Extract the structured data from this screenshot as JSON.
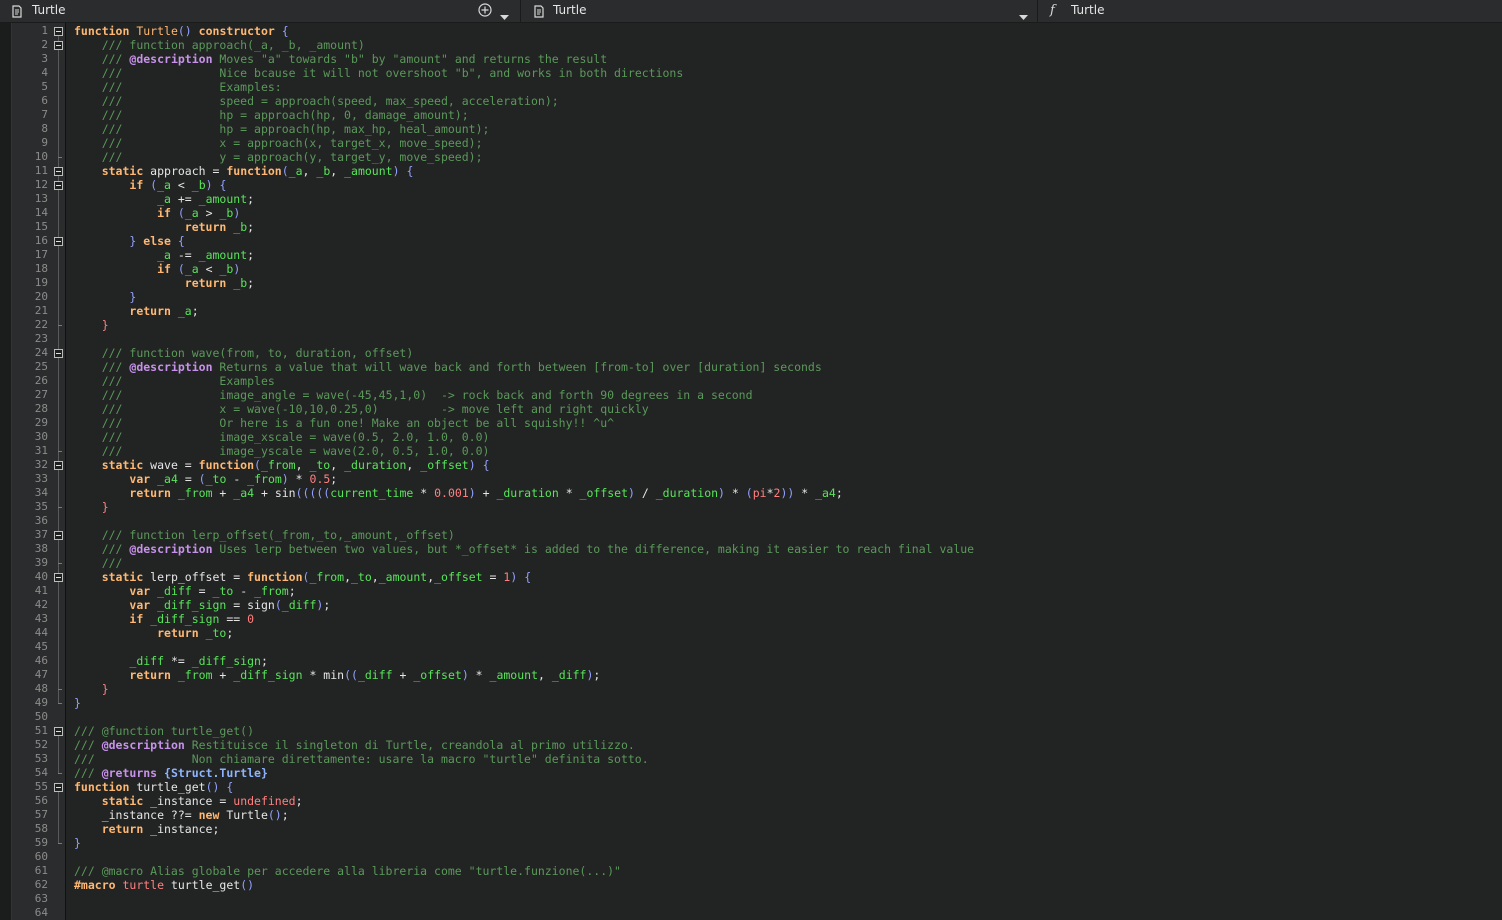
{
  "tabs": [
    {
      "label": "Turtle",
      "icon": "script-icon"
    },
    {
      "label": "Turtle",
      "icon": "script-icon"
    },
    {
      "label": "Turtle",
      "icon": "function-icon"
    }
  ],
  "colors": {
    "background": "#222323",
    "keyword": "#ffb871",
    "comment": "#5b995b",
    "local_variable": "#58e55a",
    "number": "#ff8080",
    "jsdoc_tag": "#c792ea"
  },
  "editor": {
    "line_count": 64,
    "lines": [
      [
        [
          "kw",
          "function"
        ],
        [
          "t",
          " "
        ],
        [
          "fn",
          "Turtle"
        ],
        [
          "pu",
          "()"
        ],
        [
          "t",
          " "
        ],
        [
          "kw",
          "constructor"
        ],
        [
          "t",
          " "
        ],
        [
          "pu",
          "{"
        ]
      ],
      [
        [
          "t",
          "    "
        ],
        [
          "cm",
          "/// function approach(_a, _b, _amount)"
        ]
      ],
      [
        [
          "t",
          "    "
        ],
        [
          "cm",
          "/// "
        ],
        [
          "tag",
          "@description"
        ],
        [
          "cm",
          " Moves \"a\" towards \"b\" by \"amount\" and returns the result"
        ]
      ],
      [
        [
          "t",
          "    "
        ],
        [
          "cm",
          "///              Nice bcause it will not overshoot \"b\", and works in both directions"
        ]
      ],
      [
        [
          "t",
          "    "
        ],
        [
          "cm",
          "///              Examples:"
        ]
      ],
      [
        [
          "t",
          "    "
        ],
        [
          "cm",
          "///              speed = approach(speed, max_speed, acceleration);"
        ]
      ],
      [
        [
          "t",
          "    "
        ],
        [
          "cm",
          "///              hp = approach(hp, 0, damage_amount);"
        ]
      ],
      [
        [
          "t",
          "    "
        ],
        [
          "cm",
          "///              hp = approach(hp, max_hp, heal_amount);"
        ]
      ],
      [
        [
          "t",
          "    "
        ],
        [
          "cm",
          "///              x = approach(x, target_x, move_speed);"
        ]
      ],
      [
        [
          "t",
          "    "
        ],
        [
          "cm",
          "///              y = approach(y, target_y, move_speed);"
        ]
      ],
      [
        [
          "t",
          "    "
        ],
        [
          "kw",
          "static"
        ],
        [
          "t",
          " approach = "
        ],
        [
          "kw",
          "function"
        ],
        [
          "pu",
          "("
        ],
        [
          "va",
          "_a"
        ],
        [
          "t",
          ", "
        ],
        [
          "va",
          "_b"
        ],
        [
          "t",
          ", "
        ],
        [
          "va",
          "_amount"
        ],
        [
          "pu",
          ")"
        ],
        [
          "t",
          " "
        ],
        [
          "pu",
          "{"
        ]
      ],
      [
        [
          "t",
          "        "
        ],
        [
          "kw",
          "if"
        ],
        [
          "t",
          " "
        ],
        [
          "pu",
          "("
        ],
        [
          "va",
          "_a"
        ],
        [
          "t",
          " < "
        ],
        [
          "va",
          "_b"
        ],
        [
          "pu",
          ")"
        ],
        [
          "t",
          " "
        ],
        [
          "pu",
          "{"
        ]
      ],
      [
        [
          "t",
          "            "
        ],
        [
          "va",
          "_a"
        ],
        [
          "t",
          " += "
        ],
        [
          "va",
          "_amount"
        ],
        [
          "t",
          ";"
        ]
      ],
      [
        [
          "t",
          "            "
        ],
        [
          "kw",
          "if"
        ],
        [
          "t",
          " "
        ],
        [
          "pu",
          "("
        ],
        [
          "va",
          "_a"
        ],
        [
          "t",
          " > "
        ],
        [
          "va",
          "_b"
        ],
        [
          "pu",
          ")"
        ]
      ],
      [
        [
          "t",
          "                "
        ],
        [
          "kw",
          "return"
        ],
        [
          "t",
          " "
        ],
        [
          "va",
          "_b"
        ],
        [
          "t",
          ";"
        ]
      ],
      [
        [
          "t",
          "        "
        ],
        [
          "pu",
          "}"
        ],
        [
          "t",
          " "
        ],
        [
          "kw",
          "else"
        ],
        [
          "t",
          " "
        ],
        [
          "pu",
          "{"
        ]
      ],
      [
        [
          "t",
          "            "
        ],
        [
          "va",
          "_a"
        ],
        [
          "t",
          " -= "
        ],
        [
          "va",
          "_amount"
        ],
        [
          "t",
          ";"
        ]
      ],
      [
        [
          "t",
          "            "
        ],
        [
          "kw",
          "if"
        ],
        [
          "t",
          " "
        ],
        [
          "pu",
          "("
        ],
        [
          "va",
          "_a"
        ],
        [
          "t",
          " < "
        ],
        [
          "va",
          "_b"
        ],
        [
          "pu",
          ")"
        ]
      ],
      [
        [
          "t",
          "                "
        ],
        [
          "kw",
          "return"
        ],
        [
          "t",
          " "
        ],
        [
          "va",
          "_b"
        ],
        [
          "t",
          ";"
        ]
      ],
      [
        [
          "t",
          "        "
        ],
        [
          "pu",
          "}"
        ]
      ],
      [
        [
          "t",
          "        "
        ],
        [
          "kw",
          "return"
        ],
        [
          "t",
          " "
        ],
        [
          "va",
          "_a"
        ],
        [
          "t",
          ";"
        ]
      ],
      [
        [
          "t",
          "    "
        ],
        [
          "bn",
          "}"
        ]
      ],
      [],
      [
        [
          "t",
          "    "
        ],
        [
          "cm",
          "/// function wave(from, to, duration, offset)"
        ]
      ],
      [
        [
          "t",
          "    "
        ],
        [
          "cm",
          "/// "
        ],
        [
          "tag",
          "@description"
        ],
        [
          "cm",
          " Returns a value that will wave back and forth between [from-to] over [duration] seconds"
        ]
      ],
      [
        [
          "t",
          "    "
        ],
        [
          "cm",
          "///              Examples"
        ]
      ],
      [
        [
          "t",
          "    "
        ],
        [
          "cm",
          "///              image_angle = wave(-45,45,1,0)  -> rock back and forth 90 degrees in a second"
        ]
      ],
      [
        [
          "t",
          "    "
        ],
        [
          "cm",
          "///              x = wave(-10,10,0.25,0)         -> move left and right quickly"
        ]
      ],
      [
        [
          "t",
          "    "
        ],
        [
          "cm",
          "///              Or here is a fun one! Make an object be all squishy!! ^u^"
        ]
      ],
      [
        [
          "t",
          "    "
        ],
        [
          "cm",
          "///              image_xscale = wave(0.5, 2.0, 1.0, 0.0)"
        ]
      ],
      [
        [
          "t",
          "    "
        ],
        [
          "cm",
          "///              image_yscale = wave(2.0, 0.5, 1.0, 0.0)"
        ]
      ],
      [
        [
          "t",
          "    "
        ],
        [
          "kw",
          "static"
        ],
        [
          "t",
          " wave = "
        ],
        [
          "kw",
          "function"
        ],
        [
          "pu",
          "("
        ],
        [
          "va",
          "_from"
        ],
        [
          "t",
          ", "
        ],
        [
          "va",
          "_to"
        ],
        [
          "t",
          ", "
        ],
        [
          "va",
          "_duration"
        ],
        [
          "t",
          ", "
        ],
        [
          "va",
          "_offset"
        ],
        [
          "pu",
          ")"
        ],
        [
          "t",
          " "
        ],
        [
          "pu",
          "{"
        ]
      ],
      [
        [
          "t",
          "        "
        ],
        [
          "kw",
          "var"
        ],
        [
          "t",
          " "
        ],
        [
          "va",
          "_a4"
        ],
        [
          "t",
          " = "
        ],
        [
          "pu",
          "("
        ],
        [
          "va",
          "_to"
        ],
        [
          "t",
          " - "
        ],
        [
          "va",
          "_from"
        ],
        [
          "pu",
          ")"
        ],
        [
          "t",
          " * "
        ],
        [
          "nu",
          "0.5"
        ],
        [
          "t",
          ";"
        ]
      ],
      [
        [
          "t",
          "        "
        ],
        [
          "kw",
          "return"
        ],
        [
          "t",
          " "
        ],
        [
          "va",
          "_from"
        ],
        [
          "t",
          " + "
        ],
        [
          "va",
          "_a4"
        ],
        [
          "t",
          " + sin"
        ],
        [
          "pu",
          "((((("
        ],
        [
          "va",
          "current_time"
        ],
        [
          "t",
          " * "
        ],
        [
          "nu",
          "0.001"
        ],
        [
          "pu",
          ")"
        ],
        [
          "t",
          " + "
        ],
        [
          "va",
          "_duration"
        ],
        [
          "t",
          " * "
        ],
        [
          "va",
          "_offset"
        ],
        [
          "pu",
          ")"
        ],
        [
          "t",
          " / "
        ],
        [
          "va",
          "_duration"
        ],
        [
          "pu",
          ")"
        ],
        [
          "t",
          " * "
        ],
        [
          "pu",
          "("
        ],
        [
          "nu",
          "pi"
        ],
        [
          "t",
          "*"
        ],
        [
          "nu",
          "2"
        ],
        [
          "pu",
          "))"
        ],
        [
          "t",
          " * "
        ],
        [
          "va",
          "_a4"
        ],
        [
          "t",
          ";"
        ]
      ],
      [
        [
          "t",
          "    "
        ],
        [
          "bn",
          "}"
        ]
      ],
      [],
      [
        [
          "t",
          "    "
        ],
        [
          "cm",
          "/// function lerp_offset(_from,_to,_amount,_offset)"
        ]
      ],
      [
        [
          "t",
          "    "
        ],
        [
          "cm",
          "/// "
        ],
        [
          "tag",
          "@description"
        ],
        [
          "cm",
          " Uses lerp between two values, but *_offset* is added to the difference, making it easier to reach final value"
        ]
      ],
      [
        [
          "t",
          "    "
        ],
        [
          "cm",
          "///"
        ]
      ],
      [
        [
          "t",
          "    "
        ],
        [
          "kw",
          "static"
        ],
        [
          "t",
          " lerp_offset = "
        ],
        [
          "kw",
          "function"
        ],
        [
          "pu",
          "("
        ],
        [
          "va",
          "_from"
        ],
        [
          "t",
          ","
        ],
        [
          "va",
          "_to"
        ],
        [
          "t",
          ","
        ],
        [
          "va",
          "_amount"
        ],
        [
          "t",
          ","
        ],
        [
          "va",
          "_offset"
        ],
        [
          "t",
          " = "
        ],
        [
          "nu",
          "1"
        ],
        [
          "pu",
          ")"
        ],
        [
          "t",
          " "
        ],
        [
          "pu",
          "{"
        ]
      ],
      [
        [
          "t",
          "        "
        ],
        [
          "kw",
          "var"
        ],
        [
          "t",
          " "
        ],
        [
          "va",
          "_diff"
        ],
        [
          "t",
          " = "
        ],
        [
          "va",
          "_to"
        ],
        [
          "t",
          " - "
        ],
        [
          "va",
          "_from"
        ],
        [
          "t",
          ";"
        ]
      ],
      [
        [
          "t",
          "        "
        ],
        [
          "kw",
          "var"
        ],
        [
          "t",
          " "
        ],
        [
          "va",
          "_diff_sign"
        ],
        [
          "t",
          " = sign"
        ],
        [
          "pu",
          "("
        ],
        [
          "va",
          "_diff"
        ],
        [
          "pu",
          ")"
        ],
        [
          "t",
          ";"
        ]
      ],
      [
        [
          "t",
          "        "
        ],
        [
          "kw",
          "if"
        ],
        [
          "t",
          " "
        ],
        [
          "va",
          "_diff_sign"
        ],
        [
          "t",
          " == "
        ],
        [
          "nu",
          "0"
        ]
      ],
      [
        [
          "t",
          "            "
        ],
        [
          "kw",
          "return"
        ],
        [
          "t",
          " "
        ],
        [
          "va",
          "_to"
        ],
        [
          "t",
          ";"
        ]
      ],
      [],
      [
        [
          "t",
          "        "
        ],
        [
          "va",
          "_diff"
        ],
        [
          "t",
          " *= "
        ],
        [
          "va",
          "_diff_sign"
        ],
        [
          "t",
          ";"
        ]
      ],
      [
        [
          "t",
          "        "
        ],
        [
          "kw",
          "return"
        ],
        [
          "t",
          " "
        ],
        [
          "va",
          "_from"
        ],
        [
          "t",
          " + "
        ],
        [
          "va",
          "_diff_sign"
        ],
        [
          "t",
          " * min"
        ],
        [
          "pu",
          "(("
        ],
        [
          "va",
          "_diff"
        ],
        [
          "t",
          " + "
        ],
        [
          "va",
          "_offset"
        ],
        [
          "pu",
          ")"
        ],
        [
          "t",
          " * "
        ],
        [
          "va",
          "_amount"
        ],
        [
          "t",
          ", "
        ],
        [
          "va",
          "_diff"
        ],
        [
          "pu",
          ")"
        ],
        [
          "t",
          ";"
        ]
      ],
      [
        [
          "t",
          "    "
        ],
        [
          "bn",
          "}"
        ]
      ],
      [
        [
          "pu",
          "}"
        ]
      ],
      [],
      [
        [
          "cm",
          "/// @function turtle_get()"
        ]
      ],
      [
        [
          "cm",
          "/// "
        ],
        [
          "tag",
          "@description"
        ],
        [
          "cm",
          " Restituisce il singleton di Turtle, creandola al primo utilizzo."
        ]
      ],
      [
        [
          "cm",
          "///              Non chiamare direttamente: usare la macro \"turtle\" definita sotto."
        ]
      ],
      [
        [
          "cm",
          "/// "
        ],
        [
          "tag",
          "@returns"
        ],
        [
          "t",
          " "
        ],
        [
          "ty",
          "{Struct.Turtle}"
        ]
      ],
      [
        [
          "kw",
          "function"
        ],
        [
          "t",
          " turtle_get"
        ],
        [
          "pu",
          "()"
        ],
        [
          "t",
          " "
        ],
        [
          "pu",
          "{"
        ]
      ],
      [
        [
          "t",
          "    "
        ],
        [
          "kw",
          "static"
        ],
        [
          "t",
          " _instance = "
        ],
        [
          "nu",
          "undefined"
        ],
        [
          "t",
          ";"
        ]
      ],
      [
        [
          "t",
          "    _instance ??= "
        ],
        [
          "kw",
          "new"
        ],
        [
          "t",
          " Turtle"
        ],
        [
          "pu",
          "()"
        ],
        [
          "t",
          ";"
        ]
      ],
      [
        [
          "t",
          "    "
        ],
        [
          "kw",
          "return"
        ],
        [
          "t",
          " _instance;"
        ]
      ],
      [
        [
          "pu",
          "}"
        ]
      ],
      [],
      [
        [
          "cm",
          "/// @macro Alias globale per accedere alla libreria come \"turtle.funzione(...)\""
        ]
      ],
      [
        [
          "kw",
          "#macro"
        ],
        [
          "t",
          " "
        ],
        [
          "mac",
          "turtle"
        ],
        [
          "t",
          " turtle_get"
        ],
        [
          "pu",
          "()"
        ]
      ],
      [],
      []
    ]
  }
}
